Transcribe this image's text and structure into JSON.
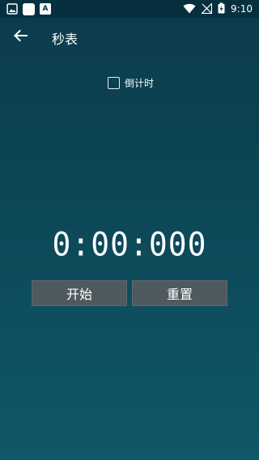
{
  "status": {
    "time": "9:10",
    "left_icons": [
      "image-icon",
      "app-icon",
      "a-icon"
    ],
    "right_icons": [
      "wifi-icon",
      "signal-off-icon",
      "battery-charging-icon"
    ]
  },
  "toolbar": {
    "title": "秒表"
  },
  "countdown": {
    "label": "倒计时",
    "checked": false
  },
  "stopwatch": {
    "display": "0:00:000"
  },
  "buttons": {
    "start_label": "开始",
    "reset_label": "重置"
  },
  "colors": {
    "bg_top": "#0b3b4c",
    "bg_bottom": "#0f5867",
    "button_bg": "#4f5a5e"
  }
}
